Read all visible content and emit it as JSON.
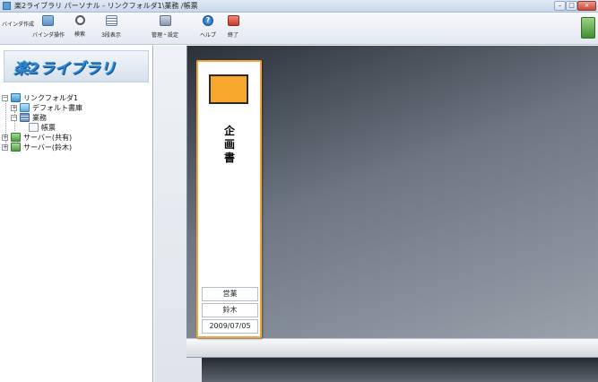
{
  "window": {
    "title": "楽2ライブラリ パーソナル - リンクフォルダ1\\業務 /帳票",
    "controls": {
      "minimize": "–",
      "maximize": "□",
      "close": "×"
    }
  },
  "toolbar": {
    "items": [
      {
        "label": "バインダ作成",
        "icon": "binder-new-icon"
      },
      {
        "label": "バインダ操作",
        "icon": "binder-op-icon"
      },
      {
        "label": "検索",
        "icon": "search-icon"
      },
      {
        "label": "3段表示",
        "icon": "three-tier-icon"
      },
      {
        "label": "管理・設定",
        "icon": "manage-icon"
      },
      {
        "label": "ヘルプ",
        "icon": "help-icon"
      },
      {
        "label": "終了",
        "icon": "exit-icon"
      }
    ]
  },
  "sidebar": {
    "logo_text": "楽2ライブラリ",
    "tree": [
      {
        "label": "リンクフォルダ1",
        "expander": "−",
        "icon": "folder-icon"
      },
      {
        "label": "デフォルト書庫",
        "expander": "+",
        "icon": "library-icon"
      },
      {
        "label": "業務",
        "expander": "−",
        "icon": "shelf-icon"
      },
      {
        "label": "帳票",
        "expander": "",
        "icon": "document-icon"
      },
      {
        "label": "サーバー(共有)",
        "expander": "+",
        "icon": "server-icon"
      },
      {
        "label": "サーバー(鈴木)",
        "expander": "+",
        "icon": "server-icon"
      }
    ]
  },
  "binder": {
    "title": "企画書",
    "color": "#f7a72c",
    "border_color": "#f3a53b",
    "department": "営業",
    "owner": "鈴木",
    "date": "2009/07/05"
  }
}
